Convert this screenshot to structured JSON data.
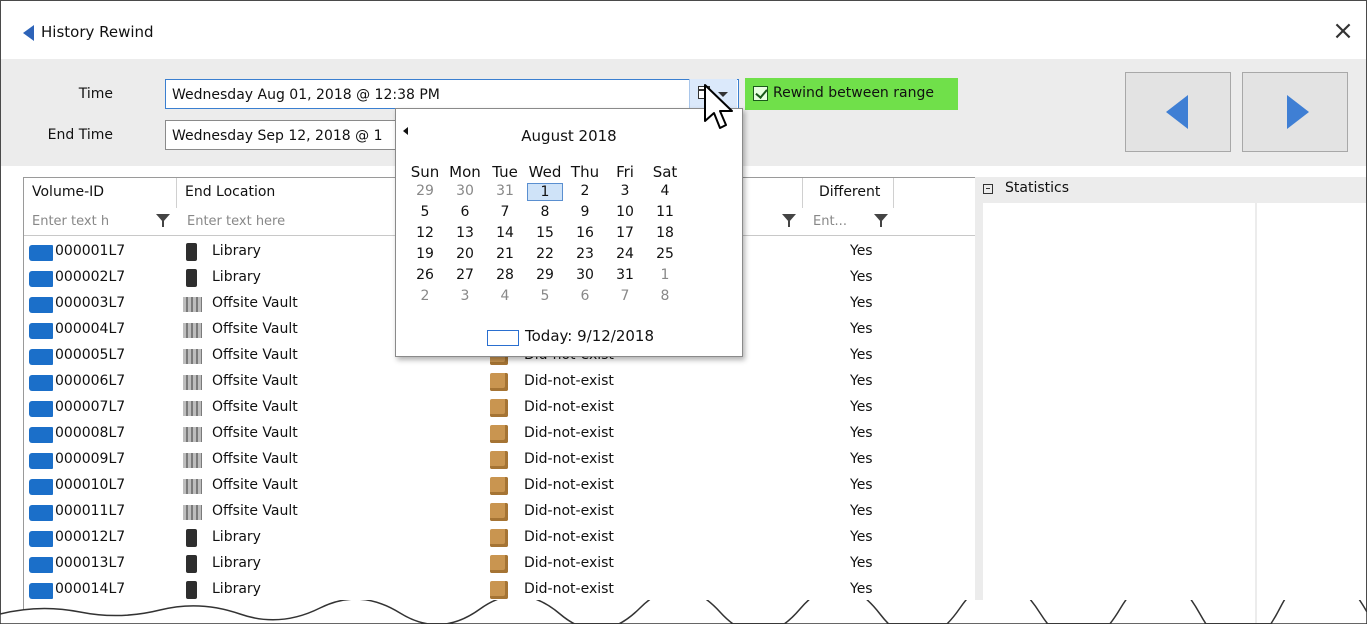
{
  "window": {
    "title": "History Rewind",
    "close_label": "×"
  },
  "toolbar": {
    "time_label": "Time",
    "time_value": "Wednesday Aug 01, 2018 @ 12:38 PM",
    "end_time_label": "End Time",
    "end_time_value": "Wednesday Sep 12, 2018 @ 1",
    "rewind_label": "Rewind between range",
    "rewind_checked": true,
    "accent_color": "#70e04a"
  },
  "grid": {
    "columns": {
      "volume_id": "Volume-ID",
      "end_location": "End Location",
      "different": "Different"
    },
    "filters": {
      "volume_id_placeholder": "Enter text h",
      "end_location_placeholder": "Enter text here",
      "different_placeholder": "Ent..."
    },
    "rows": [
      {
        "volume_id": "000001L7",
        "end_location": "Library",
        "start_location": "",
        "different": "Yes"
      },
      {
        "volume_id": "000002L7",
        "end_location": "Library",
        "start_location": "",
        "different": "Yes"
      },
      {
        "volume_id": "000003L7",
        "end_location": "Offsite Vault",
        "start_location": "",
        "different": "Yes"
      },
      {
        "volume_id": "000004L7",
        "end_location": "Offsite Vault",
        "start_location": "",
        "different": "Yes"
      },
      {
        "volume_id": "000005L7",
        "end_location": "Offsite Vault",
        "start_location": "Did-not-exist",
        "different": "Yes"
      },
      {
        "volume_id": "000006L7",
        "end_location": "Offsite Vault",
        "start_location": "Did-not-exist",
        "different": "Yes"
      },
      {
        "volume_id": "000007L7",
        "end_location": "Offsite Vault",
        "start_location": "Did-not-exist",
        "different": "Yes"
      },
      {
        "volume_id": "000008L7",
        "end_location": "Offsite Vault",
        "start_location": "Did-not-exist",
        "different": "Yes"
      },
      {
        "volume_id": "000009L7",
        "end_location": "Offsite Vault",
        "start_location": "Did-not-exist",
        "different": "Yes"
      },
      {
        "volume_id": "000010L7",
        "end_location": "Offsite Vault",
        "start_location": "Did-not-exist",
        "different": "Yes"
      },
      {
        "volume_id": "000011L7",
        "end_location": "Offsite Vault",
        "start_location": "Did-not-exist",
        "different": "Yes"
      },
      {
        "volume_id": "000012L7",
        "end_location": "Library",
        "start_location": "Did-not-exist",
        "different": "Yes"
      },
      {
        "volume_id": "000013L7",
        "end_location": "Library",
        "start_location": "Did-not-exist",
        "different": "Yes"
      },
      {
        "volume_id": "000014L7",
        "end_location": "Library",
        "start_location": "Did-not-exist",
        "different": "Yes"
      }
    ]
  },
  "statistics": {
    "title": "Statistics"
  },
  "calendar": {
    "month_title": "August 2018",
    "weekdays": [
      "Sun",
      "Mon",
      "Tue",
      "Wed",
      "Thu",
      "Fri",
      "Sat"
    ],
    "weeks": [
      [
        "29",
        "30",
        "31",
        "1",
        "2",
        "3",
        "4"
      ],
      [
        "5",
        "6",
        "7",
        "8",
        "9",
        "10",
        "11"
      ],
      [
        "12",
        "13",
        "14",
        "15",
        "16",
        "17",
        "18"
      ],
      [
        "19",
        "20",
        "21",
        "22",
        "23",
        "24",
        "25"
      ],
      [
        "26",
        "27",
        "28",
        "29",
        "30",
        "31",
        "1"
      ],
      [
        "2",
        "3",
        "4",
        "5",
        "6",
        "7",
        "8"
      ]
    ],
    "today_label": "Today: 9/12/2018"
  }
}
